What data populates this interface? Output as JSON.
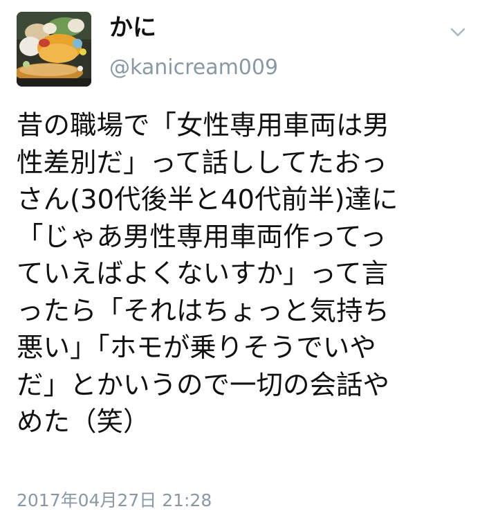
{
  "author": {
    "display_name": "かに",
    "handle": "@kanicream009"
  },
  "tweet": {
    "lines": [
      "昔の職場で「女性専用車両は男",
      "性差別だ」って話ししてたおっ",
      "さん(30代後半と40代前半)達に",
      "「じゃあ男性専用車両作ってっ",
      "ていえばよくないすか」って言",
      "ったら「それはちょっと気持ち",
      "悪い」「ホモが乗りそうでいや",
      "だ」とかいうので一切の会話や",
      "めた（笑）"
    ],
    "timestamp": "2017年04月27日 21:28"
  },
  "icons": {
    "menu": "chevron-down-icon",
    "avatar": "food-photo-avatar"
  },
  "colors": {
    "text": "#111111",
    "secondary_text": "#8899a6",
    "background": "#ffffff"
  }
}
